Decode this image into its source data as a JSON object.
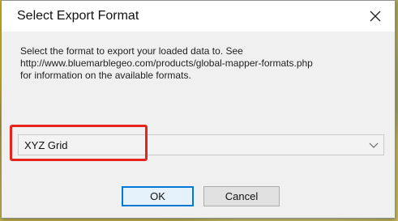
{
  "dialog": {
    "title": "Select Export Format",
    "description_lines": [
      "Select the format to export your loaded data to. See",
      "http://www.bluemarblegeo.com/products/global-mapper-formats.php",
      "for information on the available formats."
    ],
    "format_select": {
      "value": "XYZ Grid"
    },
    "ok_label": "OK",
    "cancel_label": "Cancel"
  },
  "colors": {
    "highlight": "#e8231c",
    "default_button_border": "#0078d7"
  },
  "icons": {
    "close": "close-icon",
    "dropdown": "chevron-down-icon"
  }
}
